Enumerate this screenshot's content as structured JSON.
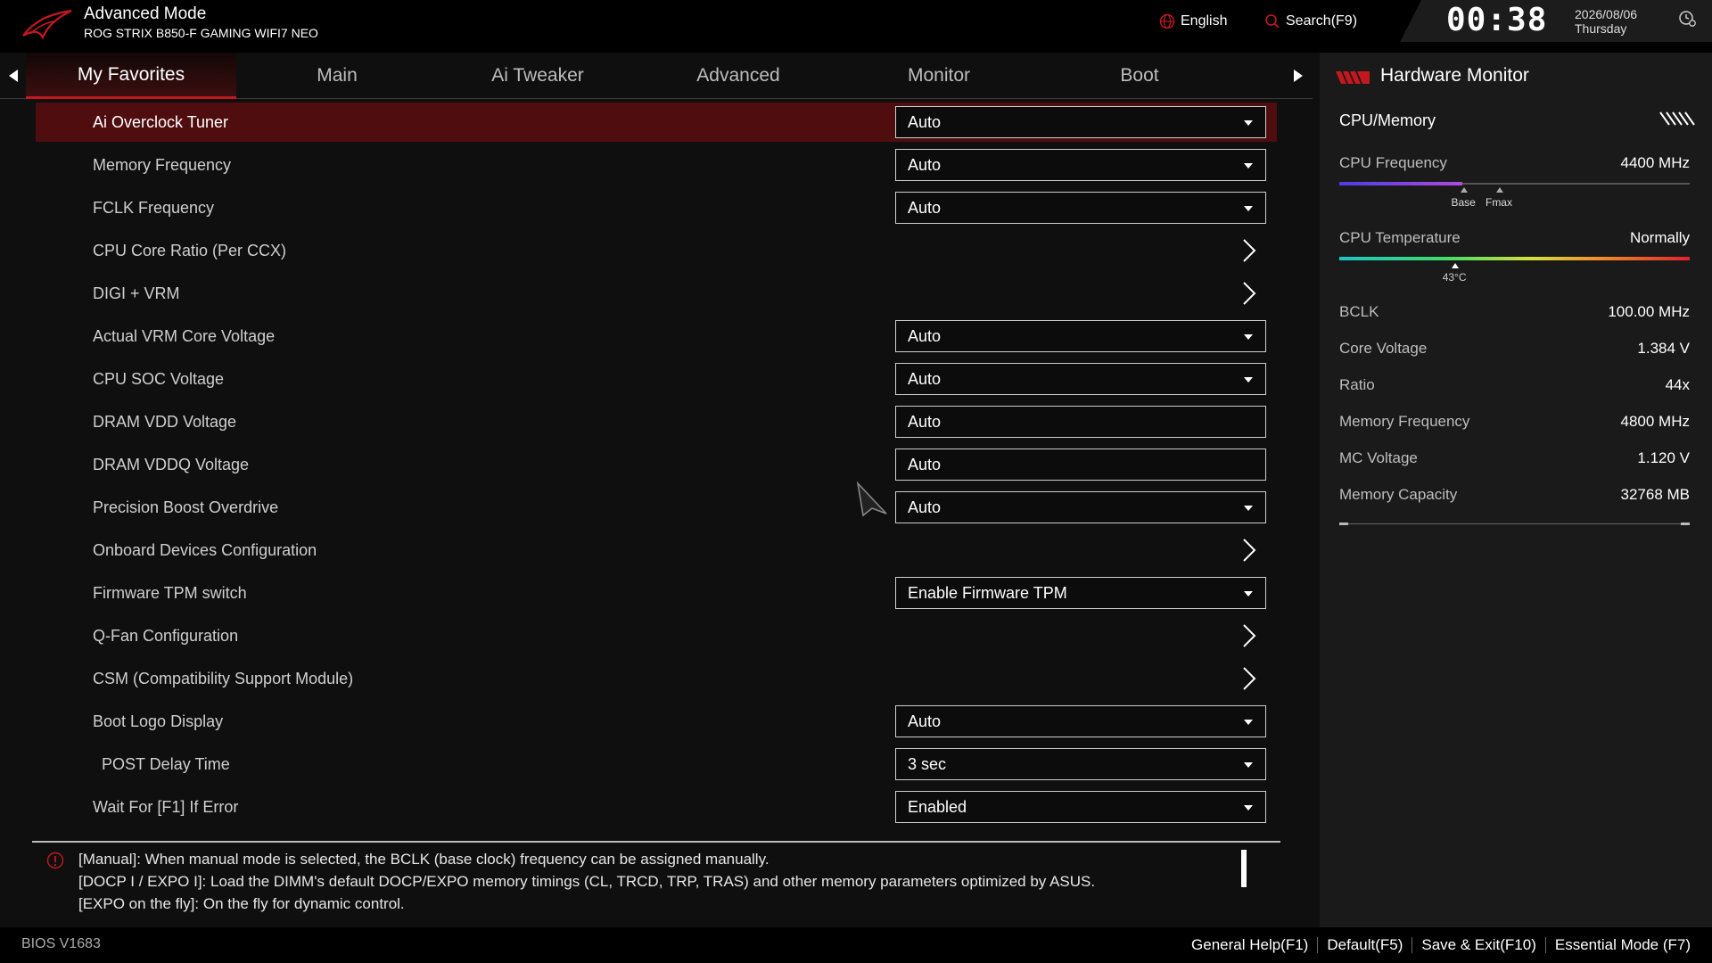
{
  "header": {
    "mode_title": "Advanced Mode",
    "board_name": "ROG STRIX B850-F GAMING WIFI7 NEO",
    "language": "English",
    "search": "Search(F9)",
    "time": "00:38",
    "date": "2026/08/06",
    "day": "Thursday",
    "accent_color": "#c4181f"
  },
  "tabs": [
    "My Favorites",
    "Main",
    "Ai Tweaker",
    "Advanced",
    "Monitor",
    "Boot"
  ],
  "active_tab": "My Favorites",
  "settings": [
    {
      "label": "Ai Overclock Tuner",
      "type": "dropdown",
      "value": "Auto"
    },
    {
      "label": "Memory Frequency",
      "type": "dropdown",
      "value": "Auto"
    },
    {
      "label": "FCLK Frequency",
      "type": "dropdown",
      "value": "Auto"
    },
    {
      "label": "CPU Core Ratio (Per CCX)",
      "type": "submenu"
    },
    {
      "label": "DIGI + VRM",
      "type": "submenu"
    },
    {
      "label": "Actual VRM Core Voltage",
      "type": "dropdown",
      "value": "Auto"
    },
    {
      "label": "CPU SOC Voltage",
      "type": "dropdown",
      "value": "Auto"
    },
    {
      "label": "DRAM VDD Voltage",
      "type": "text",
      "value": "Auto"
    },
    {
      "label": "DRAM VDDQ Voltage",
      "type": "text",
      "value": "Auto"
    },
    {
      "label": "Precision Boost Overdrive",
      "type": "dropdown",
      "value": "Auto"
    },
    {
      "label": "Onboard Devices Configuration",
      "type": "submenu"
    },
    {
      "label": "Firmware TPM switch",
      "type": "dropdown",
      "value": "Enable Firmware TPM"
    },
    {
      "label": "Q-Fan Configuration",
      "type": "submenu"
    },
    {
      "label": "CSM (Compatibility Support Module)",
      "type": "submenu"
    },
    {
      "label": "Boot Logo Display",
      "type": "dropdown",
      "value": "Auto"
    },
    {
      "label": "POST Delay Time",
      "type": "dropdown",
      "value": "3 sec"
    },
    {
      "label": "Wait For [F1] If Error",
      "type": "dropdown",
      "value": "Enabled"
    }
  ],
  "selected_setting": "Ai Overclock Tuner",
  "help": [
    "[Manual]: When manual mode is selected, the BCLK (base clock) frequency can be assigned manually.",
    "[DOCP I / EXPO I]:  Load the DIMM's default DOCP/EXPO memory timings (CL, TRCD, TRP, TRAS) and other memory parameters optimized by ASUS.",
    "[EXPO on the fly]: On the fly for dynamic control."
  ],
  "footer": {
    "version": "BIOS V1683",
    "actions": [
      "General Help(F1)",
      "Default(F5)",
      "Save & Exit(F10)",
      "Essential Mode (F7)"
    ]
  },
  "hardware_monitor": {
    "title": "Hardware Monitor",
    "section": "CPU/Memory",
    "cpu_frequency": {
      "label": "CPU Frequency",
      "value": "4400 MHz",
      "fill_fraction": 0.35,
      "base_label": "Base",
      "base_fraction": 0.355,
      "fmax_label": "Fmax",
      "fmax_fraction": 0.458
    },
    "cpu_temperature": {
      "label": "CPU Temperature",
      "value": "Normally",
      "marker_label": "43°C",
      "marker_fraction": 0.33
    },
    "readings": [
      {
        "label": "BCLK",
        "value": "100.00 MHz"
      },
      {
        "label": "Core Voltage",
        "value": "1.384 V"
      },
      {
        "label": "Ratio",
        "value": "44x"
      },
      {
        "label": "Memory Frequency",
        "value": "4800 MHz"
      },
      {
        "label": "MC Voltage",
        "value": "1.120 V"
      },
      {
        "label": "Memory Capacity",
        "value": "32768 MB"
      }
    ]
  }
}
